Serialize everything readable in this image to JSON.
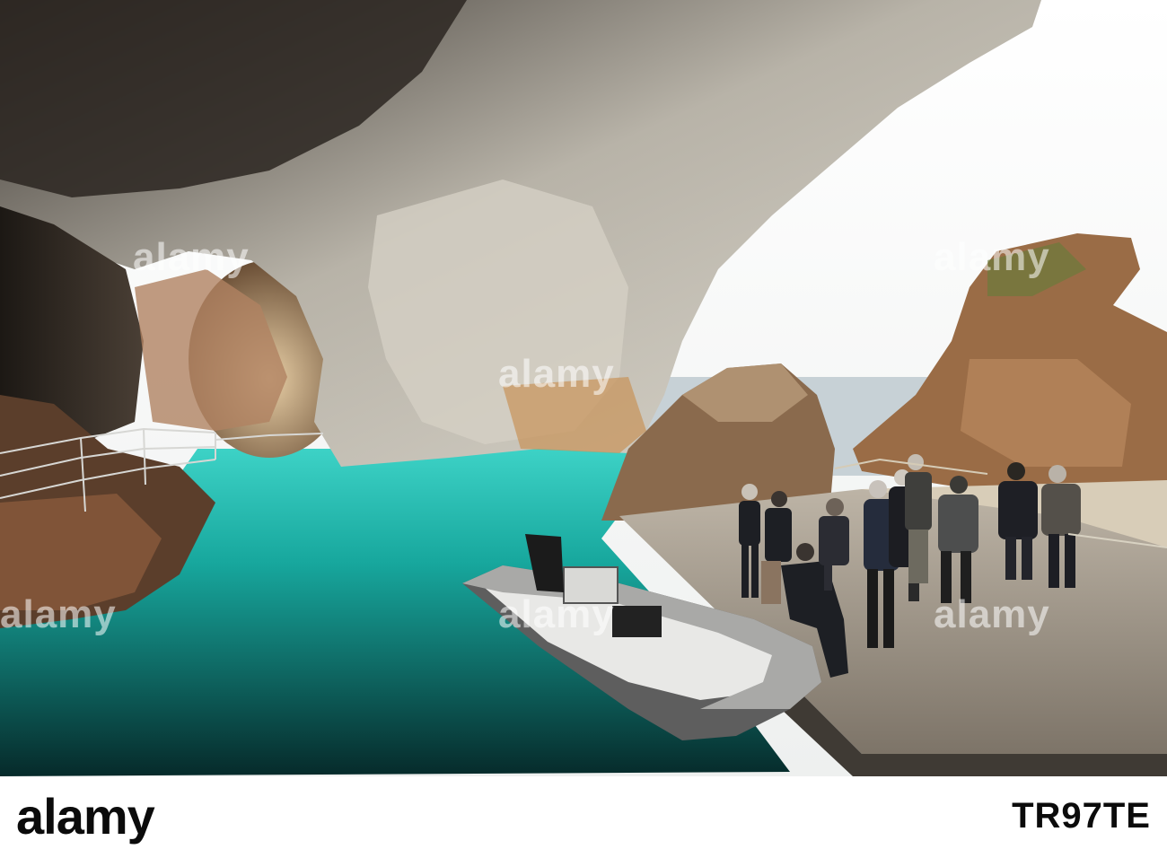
{
  "watermark": {
    "text": "alamy",
    "color": "#ffffff"
  },
  "footer": {
    "logo_text": "alamy",
    "image_id": "TR97TE"
  },
  "palette": {
    "water": "#1fb0a4",
    "rock": "#c9c6bd",
    "sky": "#f4f5f3",
    "sea": "#c9d3d8"
  }
}
